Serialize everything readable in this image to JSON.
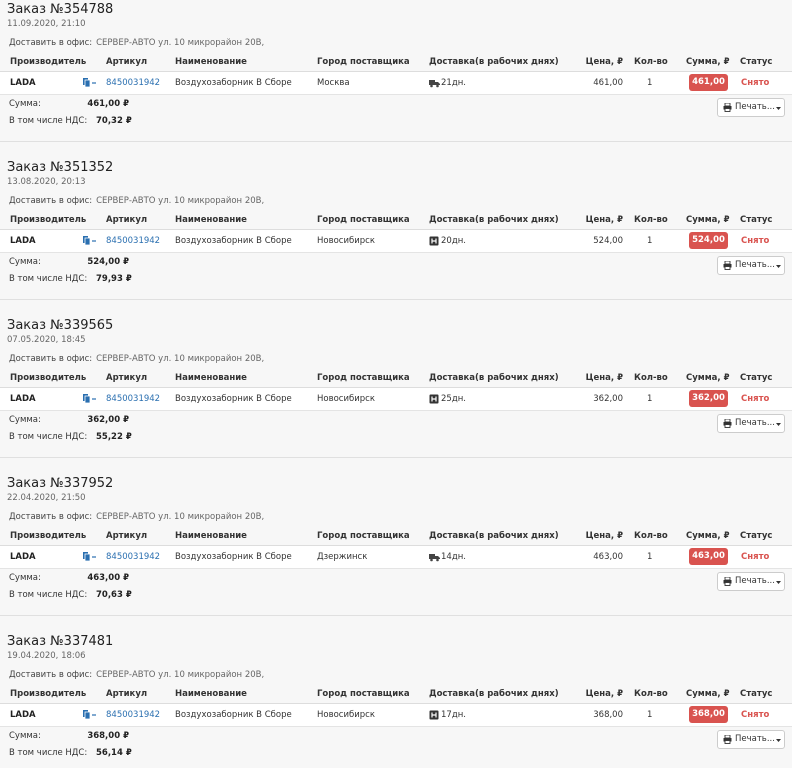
{
  "labels": {
    "deliver_to_office": "Доставить в офис:",
    "sum": "Сумма:",
    "vat_included": "В том числе НДС:",
    "print": "Печать..."
  },
  "columns": {
    "manufacturer": "Производитель",
    "article": "Артикул",
    "name": "Наименование",
    "supplier_city": "Город поставщика",
    "delivery": "Доставка(в рабочих днях)",
    "price": "Цена, ₽",
    "qty": "Кол-во",
    "sum": "Сумма, ₽",
    "status": "Статус"
  },
  "colors": {
    "badge": "#d9534f",
    "link": "#2a6fb0",
    "status": "#d9534f"
  },
  "orders": [
    {
      "title": "Заказ №354788",
      "date": "11.09.2020, 21:10",
      "address": "СЕРВЕР-АВТО ул. 10 микрорайон 20В,",
      "item": {
        "manufacturer": "LADA",
        "article": "8450031942",
        "name": "Воздухозаборник В Сборе",
        "city": "Москва",
        "delivery_icon": "truck-icon",
        "delivery": "21дн.",
        "price": "461,00",
        "qty": "1",
        "sum": "461,00",
        "status": "Снято"
      },
      "sum": "461,00 ₽",
      "vat": "70,32 ₽"
    },
    {
      "title": "Заказ №351352",
      "date": "13.08.2020, 20:13",
      "address": "СЕРВЕР-АВТО ул. 10 микрорайон 20В,",
      "item": {
        "manufacturer": "LADA",
        "article": "8450031942",
        "name": "Воздухозаборник В Сборе",
        "city": "Новосибирск",
        "delivery_icon": "warehouse-icon",
        "delivery": "20дн.",
        "price": "524,00",
        "qty": "1",
        "sum": "524,00",
        "status": "Снято"
      },
      "sum": "524,00 ₽",
      "vat": "79,93 ₽"
    },
    {
      "title": "Заказ №339565",
      "date": "07.05.2020, 18:45",
      "address": "СЕРВЕР-АВТО ул. 10 микрорайон 20В,",
      "item": {
        "manufacturer": "LADA",
        "article": "8450031942",
        "name": "Воздухозаборник В Сборе",
        "city": "Новосибирск",
        "delivery_icon": "warehouse-icon",
        "delivery": "25дн.",
        "price": "362,00",
        "qty": "1",
        "sum": "362,00",
        "status": "Снято"
      },
      "sum": "362,00 ₽",
      "vat": "55,22 ₽"
    },
    {
      "title": "Заказ №337952",
      "date": "22.04.2020, 21:50",
      "address": "СЕРВЕР-АВТО ул. 10 микрорайон 20В,",
      "item": {
        "manufacturer": "LADA",
        "article": "8450031942",
        "name": "Воздухозаборник В Сборе",
        "city": "Дзержинск",
        "delivery_icon": "truck-icon",
        "delivery": "14дн.",
        "price": "463,00",
        "qty": "1",
        "sum": "463,00",
        "status": "Снято"
      },
      "sum": "463,00 ₽",
      "vat": "70,63 ₽"
    },
    {
      "title": "Заказ №337481",
      "date": "19.04.2020, 18:06",
      "address": "СЕРВЕР-АВТО ул. 10 микрорайон 20В,",
      "item": {
        "manufacturer": "LADA",
        "article": "8450031942",
        "name": "Воздухозаборник В Сборе",
        "city": "Новосибирск",
        "delivery_icon": "warehouse-icon",
        "delivery": "17дн.",
        "price": "368,00",
        "qty": "1",
        "sum": "368,00",
        "status": "Снято"
      },
      "sum": "368,00 ₽",
      "vat": "56,14 ₽"
    }
  ]
}
